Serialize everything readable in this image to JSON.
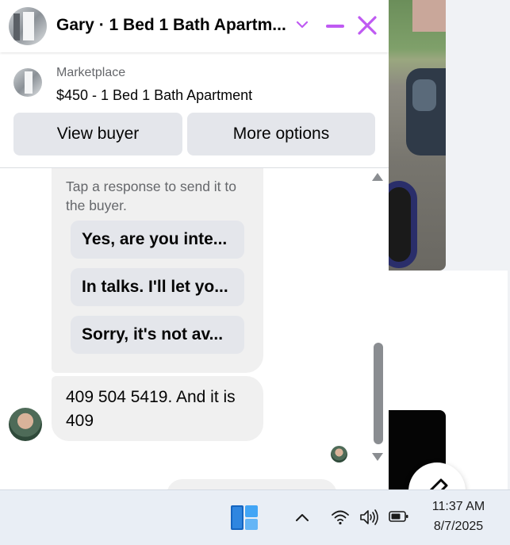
{
  "chat": {
    "title": "Gary · 1 Bed 1 Bath Apartm...",
    "accent_color": "#bf5af2"
  },
  "listing": {
    "subtitle": "Marketplace",
    "price_title": "$450 - 1 Bed 1 Bath Apartment",
    "view_buyer_label": "View buyer",
    "more_options_label": "More options"
  },
  "messages": {
    "tap_prompt": "Tap a response to send it to the buyer.",
    "quick_responses": [
      "Yes, are you inte...",
      "In talks. I'll let yo...",
      "Sorry, it's not av..."
    ],
    "incoming_text": "409 504 5419. And it is 409"
  },
  "taskbar": {
    "time": "11:37 AM",
    "date": "8/7/2025"
  }
}
